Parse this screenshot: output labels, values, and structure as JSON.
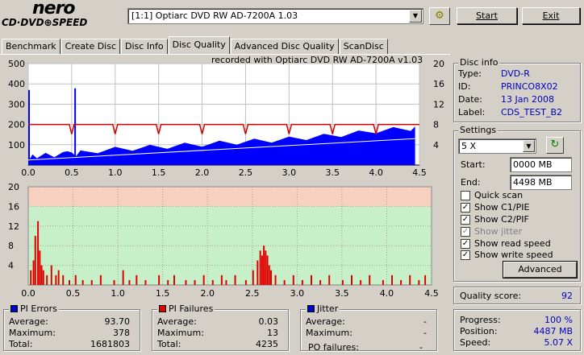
{
  "logo": {
    "line1": "nero",
    "line2": "CD·DVD⊕SPEED"
  },
  "drive": {
    "selected": "[1:1]  Optiarc DVD RW AD-7200A 1.03"
  },
  "toolbar": {
    "start_label": "Start",
    "exit_label": "Exit",
    "icon": "eject-swap-icon"
  },
  "tabs": [
    "Benchmark",
    "Create Disc",
    "Disc Info",
    "Disc Quality",
    "Advanced Disc Quality",
    "ScanDisc"
  ],
  "active_tab": "Disc Quality",
  "chart_caption": "recorded with Optiarc DVD RW AD-7200A  v1.03",
  "disc_info": {
    "title": "Disc info",
    "type_label": "Type:",
    "type": "DVD-R",
    "id_label": "ID:",
    "id": "PRINCO8X02",
    "date_label": "Date:",
    "date": "13 Jan 2008",
    "label_label": "Label:",
    "label": "CDS_TEST_B2"
  },
  "settings": {
    "title": "Settings",
    "speed": "5 X",
    "start_label": "Start:",
    "start": "0000 MB",
    "end_label": "End:",
    "end": "4498 MB",
    "quick_scan": "Quick scan",
    "show_c1": "Show C1/PIE",
    "show_c2": "Show C2/PIF",
    "show_jitter": "Show jitter",
    "show_read": "Show read speed",
    "show_write": "Show write speed",
    "advanced_label": "Advanced"
  },
  "quality": {
    "label": "Quality score:",
    "value": "92"
  },
  "progress": {
    "progress_label": "Progress:",
    "progress": "100 %",
    "position_label": "Position:",
    "position": "4487 MB",
    "speed_label": "Speed:",
    "speed": "5.07 X"
  },
  "pi_errors": {
    "title": "PI Errors",
    "color": "#0000c8",
    "avg_label": "Average:",
    "avg": "93.70",
    "max_label": "Maximum:",
    "max": "378",
    "total_label": "Total:",
    "total": "1681803"
  },
  "pi_failures": {
    "title": "PI Failures",
    "color": "#e00000",
    "avg_label": "Average:",
    "avg": "0.03",
    "max_label": "Maximum:",
    "max": "13",
    "total_label": "Total:",
    "total": "4235"
  },
  "jitter": {
    "title": "Jitter",
    "color": "#0000c8",
    "avg_label": "Average:",
    "avg": "-",
    "max_label": "Maximum:",
    "max": "-",
    "po_label": "PO failures:",
    "po": "-"
  },
  "chart_data": [
    {
      "type": "area",
      "title": "",
      "x_ticks": [
        "0.0",
        "0.5",
        "1.0",
        "1.5",
        "2.0",
        "2.5",
        "3.0",
        "3.5",
        "4.0",
        "4.5"
      ],
      "y_left_ticks": [
        "100",
        "200",
        "300",
        "400",
        "500"
      ],
      "y_right_ticks": [
        "4",
        "8",
        "12",
        "16",
        "20"
      ],
      "xlim": [
        0,
        4.5
      ],
      "ylim": [
        0,
        500
      ],
      "y2lim": [
        0,
        20
      ],
      "series": [
        {
          "name": "PI Errors",
          "color": "#0000ff",
          "x": [
            0.0,
            0.05,
            0.1,
            0.2,
            0.3,
            0.4,
            0.45,
            0.5,
            0.55,
            0.6,
            0.8,
            1.0,
            1.2,
            1.4,
            1.6,
            1.8,
            2.0,
            2.2,
            2.4,
            2.6,
            2.8,
            3.0,
            3.2,
            3.4,
            3.6,
            3.8,
            4.0,
            4.2,
            4.4,
            4.45
          ],
          "y": [
            30,
            40,
            45,
            48,
            50,
            52,
            80,
            50,
            55,
            60,
            70,
            78,
            82,
            88,
            92,
            98,
            102,
            108,
            112,
            118,
            122,
            128,
            135,
            142,
            150,
            158,
            168,
            175,
            180,
            178
          ]
        },
        {
          "name": "PI Errors spikes",
          "color": "#0000ff",
          "x": [
            0.0,
            0.53
          ],
          "y": [
            370,
            378
          ]
        }
      ],
      "write_speed": {
        "color": "#d00000",
        "level": 8.0,
        "dips": [
          0.5,
          1.0,
          1.5,
          2.0,
          2.5,
          3.0,
          3.5,
          4.0
        ]
      },
      "read_speed": {
        "color": "#ffffff",
        "x": [
          0.0,
          4.45
        ],
        "y": [
          1.0,
          5.2
        ]
      }
    },
    {
      "type": "bar",
      "title": "",
      "x_ticks": [
        "0.0",
        "0.5",
        "1.0",
        "1.5",
        "2.0",
        "2.5",
        "3.0",
        "3.5",
        "4.0",
        "4.5"
      ],
      "y_ticks": [
        "4",
        "8",
        "12",
        "16",
        "20"
      ],
      "xlim": [
        0,
        4.5
      ],
      "ylim": [
        0,
        20
      ],
      "bands": [
        {
          "from": 0,
          "to": 16,
          "color": "#c8f0c8"
        },
        {
          "from": 16,
          "to": 20,
          "color": "#f8d0c0"
        }
      ],
      "series": [
        {
          "name": "PI Failures",
          "color": "#e00000",
          "x": [
            0.02,
            0.05,
            0.07,
            0.1,
            0.12,
            0.14,
            0.16,
            0.2,
            0.25,
            0.3,
            0.33,
            0.38,
            0.45,
            0.52,
            0.6,
            0.7,
            0.8,
            0.95,
            1.05,
            1.12,
            1.2,
            1.3,
            1.45,
            1.55,
            1.62,
            1.75,
            1.85,
            1.95,
            2.05,
            2.15,
            2.2,
            2.3,
            2.42,
            2.5,
            2.55,
            2.58,
            2.6,
            2.62,
            2.64,
            2.66,
            2.68,
            2.7,
            2.75,
            2.85,
            2.95,
            3.05,
            3.15,
            3.25,
            3.35,
            3.5,
            3.6,
            3.7,
            3.8,
            3.95,
            4.05,
            4.15,
            4.25,
            4.35,
            4.42
          ],
          "y": [
            3,
            5,
            10,
            13,
            7,
            4,
            3,
            2,
            4,
            2,
            3,
            2,
            1,
            2,
            1,
            1,
            2,
            1,
            3,
            1,
            2,
            1,
            2,
            1,
            2,
            1,
            1,
            2,
            1,
            2,
            1,
            2,
            1,
            3,
            5,
            7,
            6,
            8,
            7,
            6,
            4,
            3,
            2,
            1,
            2,
            1,
            2,
            1,
            2,
            1,
            2,
            1,
            2,
            1,
            2,
            1,
            2,
            1,
            2
          ]
        }
      ]
    }
  ]
}
